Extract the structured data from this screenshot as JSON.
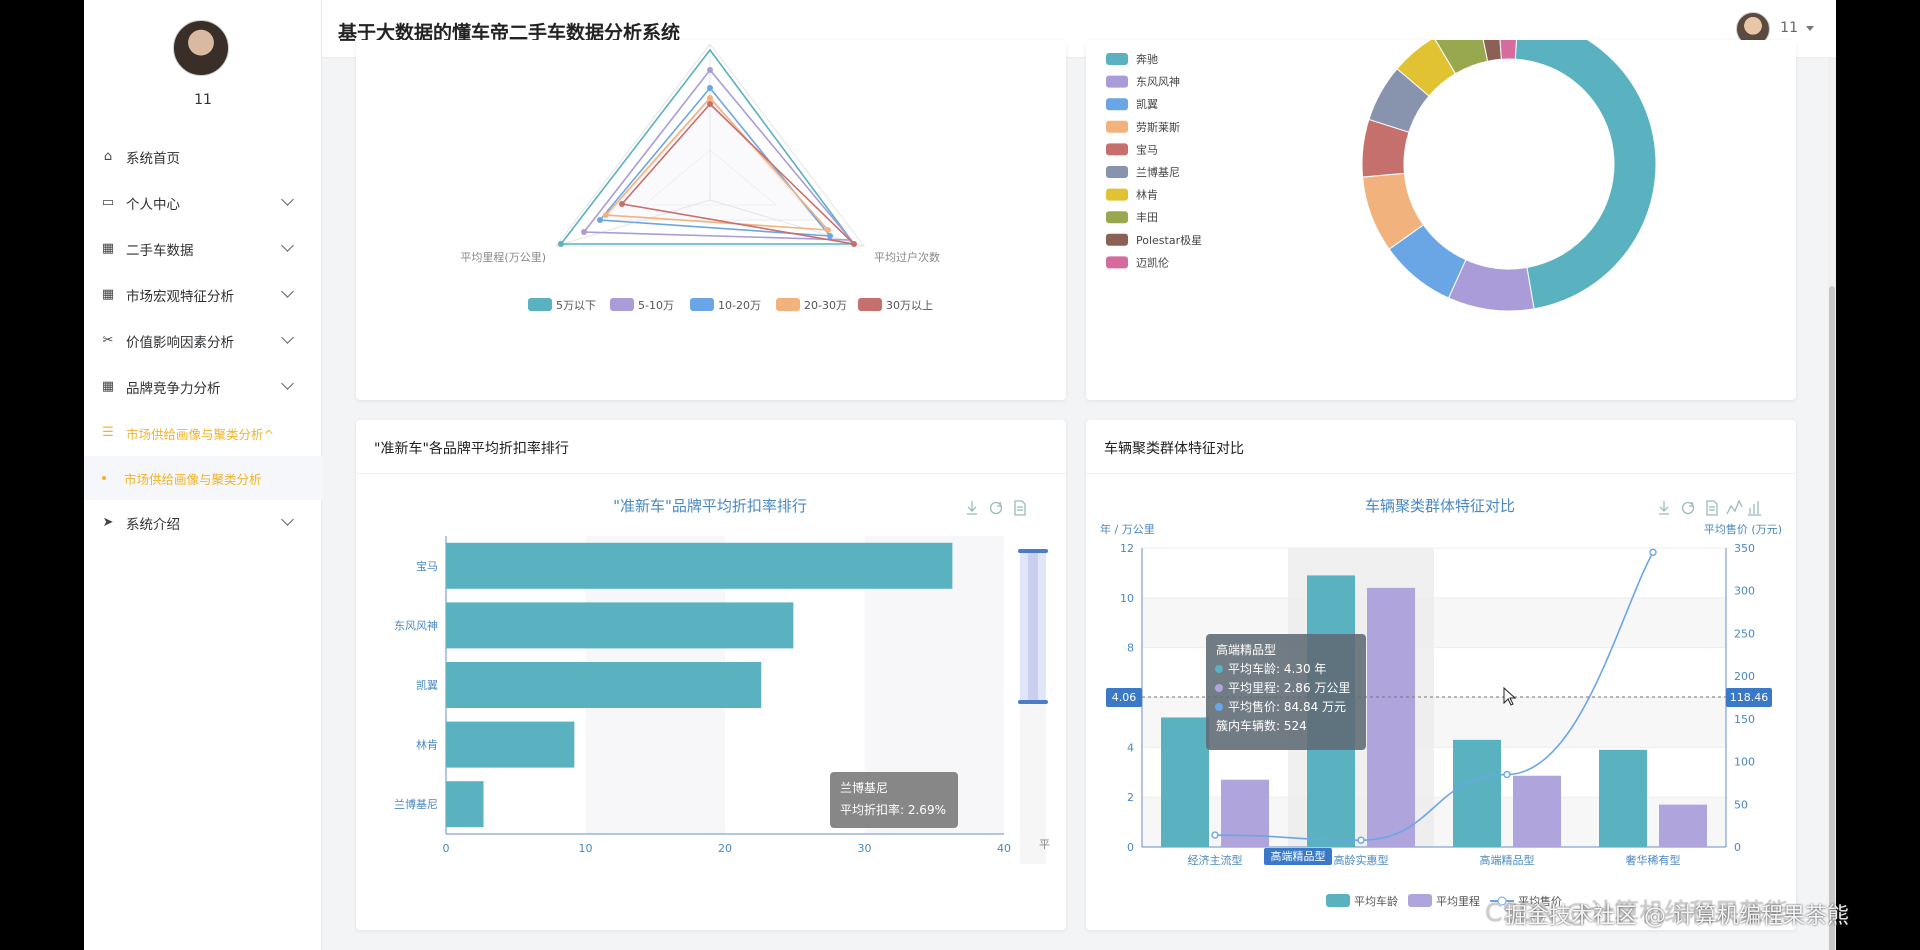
{
  "app": {
    "title": "基于大数据的懂车帝二手车数据分析系统",
    "user": "11"
  },
  "sidebar": {
    "user": "11",
    "items": [
      {
        "label": "系统首页",
        "icon": "home-icon"
      },
      {
        "label": "个人中心",
        "icon": "card-icon"
      },
      {
        "label": "二手车数据",
        "icon": "grid-icon"
      },
      {
        "label": "市场宏观特征分析",
        "icon": "grid-icon"
      },
      {
        "label": "价值影响因素分析",
        "icon": "ticket-icon"
      },
      {
        "label": "品牌竞争力分析",
        "icon": "grid-icon"
      },
      {
        "label": "市场供给画像与聚类分析^",
        "icon": "list-icon"
      },
      {
        "label": "系统介绍",
        "icon": "send-icon"
      }
    ],
    "subitem": "市场供给画像与聚类分析"
  },
  "radar": {
    "indicators": [
      "平均里程(万公里)",
      "平均过户次数"
    ],
    "legend": [
      "5万以下",
      "5-10万",
      "10-20万",
      "20-30万",
      "30万以上"
    ],
    "colors": [
      "#5ab1c0",
      "#a99cd9",
      "#6aa6e6",
      "#f2b27e",
      "#c6706d"
    ]
  },
  "pie": {
    "legend": [
      "奔驰",
      "东风风神",
      "凯翼",
      "劳斯莱斯",
      "宝马",
      "兰博基尼",
      "林肯",
      "丰田",
      "Polestar极星",
      "迈凯伦"
    ],
    "colors": [
      "#5ab1c0",
      "#a99cd9",
      "#6aa6e6",
      "#f2b27e",
      "#c6706d",
      "#8893ae",
      "#e1c232",
      "#97a84e",
      "#8c6054",
      "#d66b9e"
    ]
  },
  "discount_card": {
    "header": "\"准新车\"各品牌平均折扣率排行",
    "chart_title": "\"准新车\"品牌平均折扣率排行",
    "tooltip_title": "兰博基尼",
    "tooltip_line": "平均折扣率: 2.69%",
    "axis_tail": "平"
  },
  "cluster_card": {
    "header": "车辆聚类群体特征对比",
    "chart_title": "车辆聚类群体特征对比",
    "y_left_name": "年 / 万公里",
    "y_right_name": "平均售价 (万元)",
    "pointer_left": "4.06",
    "pointer_right": "118.46",
    "x_highlight": "高端精品型",
    "tooltip": {
      "title": "高端精品型",
      "rows": [
        "平均车龄: 4.30 年",
        "平均里程: 2.86 万公里",
        "平均售价: 84.84 万元"
      ],
      "count": "簇内车辆数: 524"
    },
    "legend": [
      "平均车龄",
      "平均里程",
      "平均售价"
    ]
  },
  "watermark": "CSDN @计算机编程果茶熊",
  "watermark_overlay": "掘金技术社区 @ 计算机编程果茶熊",
  "chart_data": [
    {
      "type": "bar",
      "orientation": "horizontal",
      "title": "\"准新车\"品牌平均折扣率排行",
      "categories": [
        "宝马",
        "东风风神",
        "凯翼",
        "林肯",
        "兰博基尼"
      ],
      "values": [
        36.3,
        24.9,
        22.6,
        9.2,
        2.69
      ],
      "xlim": [
        0,
        40
      ],
      "xticks": [
        0,
        10,
        20,
        30,
        40
      ],
      "color": "#5ab1c0"
    },
    {
      "type": "bar",
      "title": "车辆聚类群体特征对比",
      "categories": [
        "经济主流型",
        "高龄实惠型",
        "高端精品型",
        "奢华稀有型"
      ],
      "series": [
        {
          "name": "平均车龄",
          "type": "bar",
          "axis": "left",
          "values": [
            5.2,
            10.9,
            4.3,
            3.9
          ],
          "color": "#5ab1c0"
        },
        {
          "name": "平均里程",
          "type": "bar",
          "axis": "left",
          "values": [
            2.7,
            10.4,
            2.86,
            1.7
          ],
          "color": "#b0a4dc"
        },
        {
          "name": "平均售价",
          "type": "line",
          "axis": "right",
          "values": [
            14,
            8,
            84.84,
            345
          ],
          "color": "#6aa6e6"
        }
      ],
      "ylim_left": [
        0,
        12
      ],
      "yticks_left": [
        0,
        2,
        4,
        6,
        8,
        10,
        12
      ],
      "ylim_right": [
        0,
        350
      ],
      "yticks_right": [
        0,
        50,
        100,
        150,
        200,
        250,
        300,
        350
      ]
    },
    {
      "type": "pie",
      "categories": [
        "奔驰",
        "东风风神",
        "凯翼",
        "劳斯莱斯",
        "宝马",
        "兰博基尼",
        "林肯",
        "丰田",
        "Polestar极星",
        "迈凯伦"
      ],
      "values": [
        44,
        9,
        8,
        8,
        6,
        6,
        5,
        5,
        2,
        2
      ]
    },
    {
      "type": "radar",
      "indicators": [
        "平均里程(万公里)",
        "平均过户次数"
      ],
      "series_names": [
        "5万以下",
        "5-10万",
        "10-20万",
        "20-30万",
        "30万以上"
      ]
    }
  ]
}
